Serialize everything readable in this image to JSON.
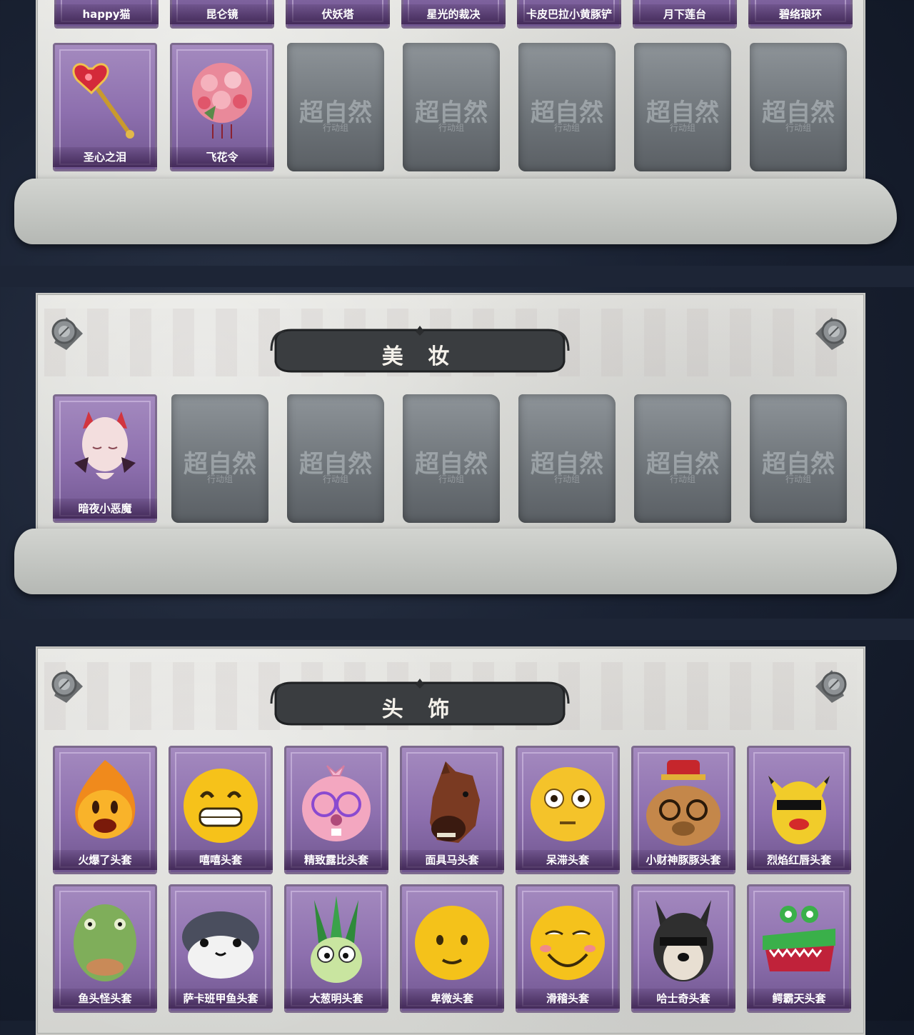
{
  "watermark": {
    "main": "超自然",
    "sub": "行动组"
  },
  "colors": {
    "card_purple": "#8d6fae",
    "stone_gray": "#6d7378",
    "banner_dark": "#3a3d40",
    "panel_light": "#dedfdb"
  },
  "section_top": {
    "row1": [
      "happy猫",
      "昆仑镜",
      "伏妖塔",
      "星光的裁决",
      "卡皮巴拉小黄豚铲",
      "月下莲台",
      "碧络琅环"
    ],
    "row2": [
      {
        "label": "圣心之泪",
        "icon": "heart-scepter-icon"
      },
      {
        "label": "飞花令",
        "icon": "flower-ball-icon"
      }
    ],
    "empty_slots": 5
  },
  "section_makeup": {
    "title": "美 妆",
    "items": [
      {
        "label": "暗夜小恶魔",
        "icon": "devil-face-icon"
      }
    ],
    "empty_slots": 6
  },
  "section_headwear": {
    "title": "头 饰",
    "row1": [
      {
        "label": "火爆了头套",
        "icon": "fire-head-icon"
      },
      {
        "label": "嘻嘻头套",
        "icon": "grin-emoji-head-icon"
      },
      {
        "label": "精致露比头套",
        "icon": "pink-beaver-head-icon"
      },
      {
        "label": "面具马头套",
        "icon": "horse-mask-icon"
      },
      {
        "label": "呆滞头套",
        "icon": "dazed-emoji-head-icon"
      },
      {
        "label": "小财神豚豚头套",
        "icon": "capybara-god-head-icon"
      },
      {
        "label": "烈焰红唇头套",
        "icon": "pikachu-lips-head-icon"
      }
    ],
    "row2": [
      {
        "label": "鱼头怪头套",
        "icon": "fish-head-icon"
      },
      {
        "label": "萨卡班甲鱼头套",
        "icon": "sacabambaspis-head-icon"
      },
      {
        "label": "大葱明头套",
        "icon": "scallion-head-icon"
      },
      {
        "label": "卑微头套",
        "icon": "humble-emoji-head-icon"
      },
      {
        "label": "滑稽头套",
        "icon": "funny-emoji-head-icon"
      },
      {
        "label": "哈士奇头套",
        "icon": "husky-head-icon"
      },
      {
        "label": "鳄霸天头套",
        "icon": "crocodile-head-icon"
      }
    ]
  }
}
